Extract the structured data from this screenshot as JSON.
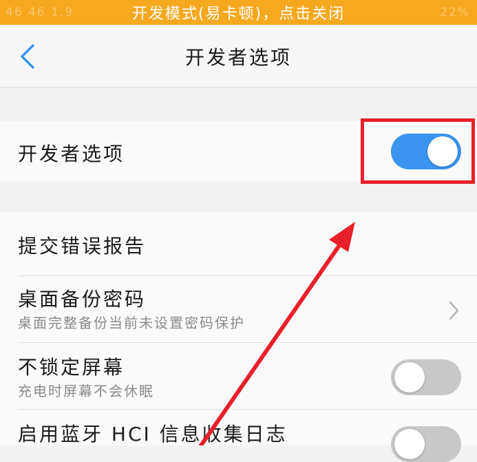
{
  "status_bar": {
    "banner": "开发模式(易卡顿)，点击关闭",
    "left_faint": "46 46 1.9",
    "right_faint": "22%",
    "background": "#f7a821"
  },
  "header": {
    "title": "开发者选项",
    "back_icon": "chevron-left-icon"
  },
  "developer_toggle": {
    "label": "开发者选项",
    "state": "on",
    "color": "#3b94f0"
  },
  "settings": [
    {
      "label": "提交错误报告"
    },
    {
      "label": "桌面备份密码",
      "subtitle": "桌面完整备份当前未设置密码保护",
      "control": "chevron-right-icon"
    },
    {
      "label": "不锁定屏幕",
      "subtitle": "充电时屏幕不会休眠",
      "control": "toggle",
      "state": "off"
    },
    {
      "label": "启用蓝牙 HCI 信息收集日志",
      "control": "toggle",
      "state": "off"
    }
  ],
  "annotation": {
    "highlight_color": "#e8202a"
  }
}
